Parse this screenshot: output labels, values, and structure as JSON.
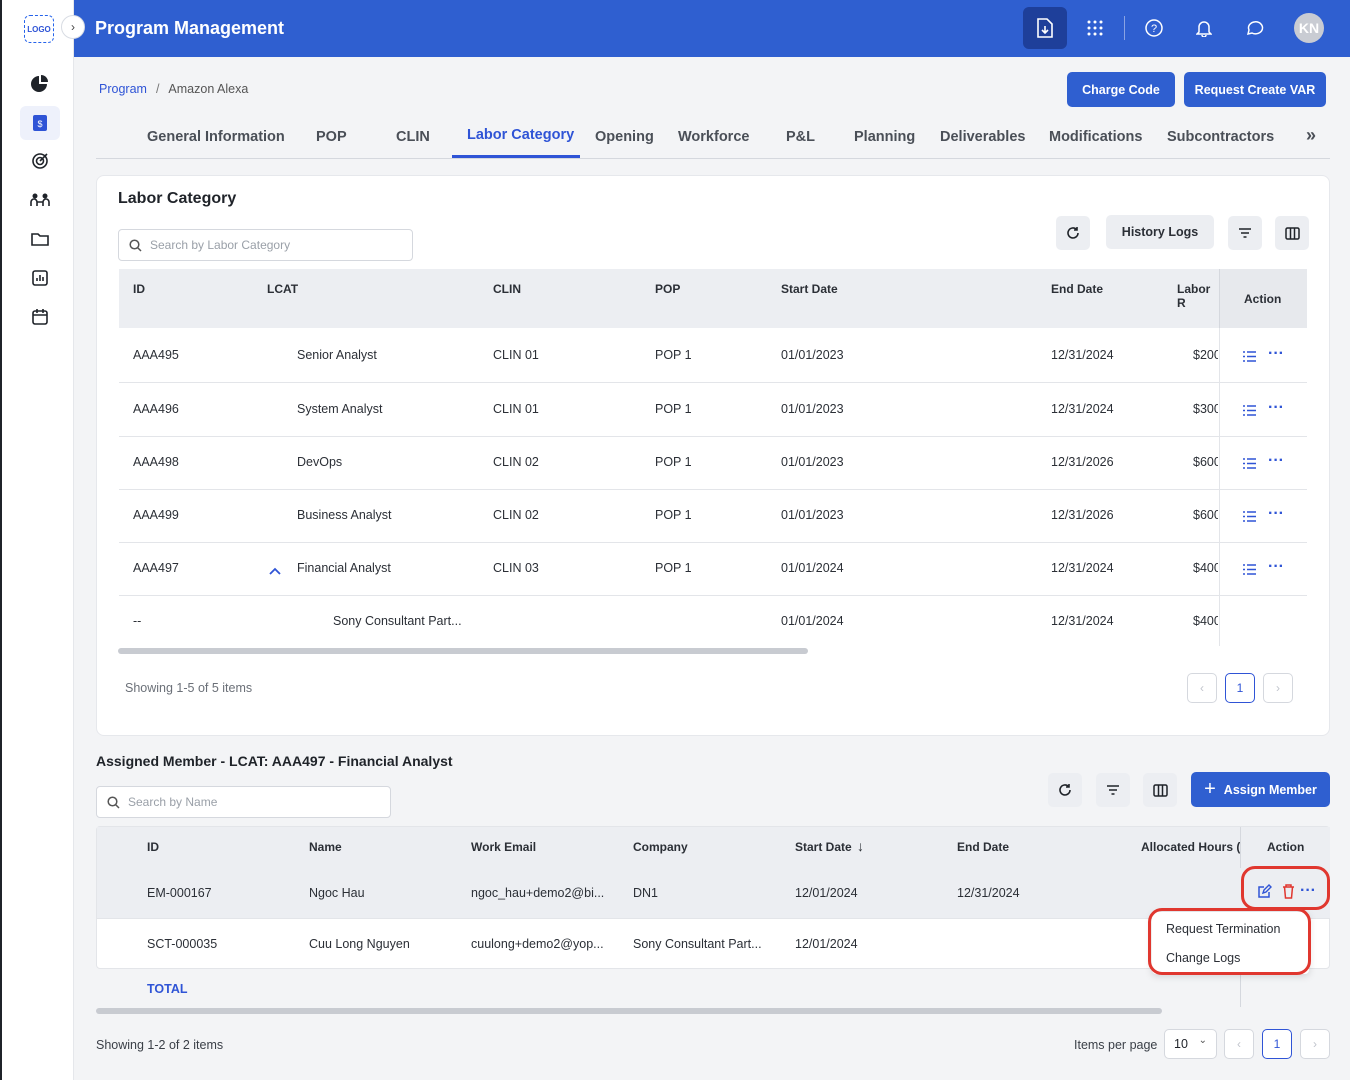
{
  "logo_text": "LOGO",
  "app_title": "Program Management",
  "topbar_icons": [
    "download-doc-icon",
    "apps-grid-icon",
    "help-icon",
    "bell-icon",
    "chat-icon"
  ],
  "avatar_initials": "KN",
  "breadcrumb": {
    "root": "Program",
    "sep": "/",
    "current": "Amazon Alexa"
  },
  "actions": {
    "charge_code": "Charge Code",
    "request_var": "Request Create VAR"
  },
  "tabs": [
    "General Information",
    "POP",
    "CLIN",
    "Labor Category",
    "Opening",
    "Workforce",
    "P&L",
    "Planning",
    "Deliverables",
    "Modifications",
    "Subcontractors"
  ],
  "tabs_more": "»",
  "labor": {
    "title": "Labor Category",
    "search_placeholder": "Search by Labor Category",
    "history_logs": "History Logs",
    "headers": {
      "id": "ID",
      "lcat": "LCAT",
      "clin": "CLIN",
      "pop": "POP",
      "start": "Start Date",
      "end": "End Date",
      "rate": "Labor R",
      "action": "Action"
    },
    "rows": [
      {
        "id": "AAA495",
        "lcat": "Senior Analyst",
        "clin": "CLIN 01",
        "pop": "POP 1",
        "start": "01/01/2023",
        "end": "12/31/2024",
        "rate": "$200"
      },
      {
        "id": "AAA496",
        "lcat": "System Analyst",
        "clin": "CLIN 01",
        "pop": "POP 1",
        "start": "01/01/2023",
        "end": "12/31/2024",
        "rate": "$300"
      },
      {
        "id": "AAA498",
        "lcat": "DevOps",
        "clin": "CLIN 02",
        "pop": "POP 1",
        "start": "01/01/2023",
        "end": "12/31/2026",
        "rate": "$600"
      },
      {
        "id": "AAA499",
        "lcat": "Business Analyst",
        "clin": "CLIN 02",
        "pop": "POP 1",
        "start": "01/01/2023",
        "end": "12/31/2026",
        "rate": "$600"
      },
      {
        "id": "AAA497",
        "lcat": "Financial Analyst",
        "clin": "CLIN 03",
        "pop": "POP 1",
        "start": "01/01/2024",
        "end": "12/31/2024",
        "rate": "$400"
      }
    ],
    "sub_row": {
      "id": "--",
      "lcat": "Sony Consultant Part...",
      "start": "01/01/2024",
      "end": "12/31/2024",
      "rate": "$400"
    },
    "showing": "Showing 1-5 of 5 items",
    "page": "1"
  },
  "members": {
    "title": "Assigned Member - LCAT: AAA497 - Financial Analyst",
    "search_placeholder": "Search by Name",
    "assign_button": "Assign Member",
    "headers": {
      "id": "ID",
      "name": "Name",
      "email": "Work Email",
      "company": "Company",
      "start": "Start Date",
      "end": "End Date",
      "hours": "Allocated Hours (",
      "action": "Action"
    },
    "rows": [
      {
        "id": "EM-000167",
        "name": "Ngoc Hau",
        "email": "ngoc_hau+demo2@bi...",
        "company": "DN1",
        "start": "12/01/2024",
        "end": "12/31/2024"
      },
      {
        "id": "SCT-000035",
        "name": "Cuu Long Nguyen",
        "email": "cuulong+demo2@yop...",
        "company": "Sony Consultant Part...",
        "start": "12/01/2024",
        "end": ""
      }
    ],
    "total_label": "TOTAL",
    "showing": "Showing 1-2 of 2 items",
    "items_per_page_label": "Items per page",
    "items_per_page": "10",
    "page": "1"
  },
  "menu": {
    "request_termination": "Request Termination",
    "change_logs": "Change Logs"
  },
  "colors": {
    "primary": "#2f5fd0",
    "highlight": "#e0372f"
  }
}
